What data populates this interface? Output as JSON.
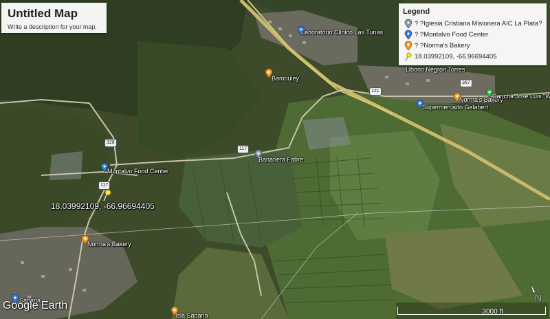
{
  "map": {
    "title": "Untitled Map",
    "description": "Write a description for your map.",
    "logo": "Google Earth",
    "scale_label": "3000 ft",
    "compass": "N"
  },
  "legend": {
    "heading": "Legend",
    "items": [
      {
        "label": "? ?Iglesia Cristiana Misionera AIC La Plata?",
        "icon": "gray-pin-icon",
        "color": "#8a9bb0"
      },
      {
        "label": "? ?Montalvo Food Center",
        "icon": "blue-pin-icon",
        "color": "#3b7ad9"
      },
      {
        "label": "? ?Norma's Bakery",
        "icon": "orange-pin-icon",
        "color": "#f0a028"
      },
      {
        "label": "18.03992109, -66.96694405",
        "icon": "yellow-pushpin-icon",
        "color": "#f4e62a"
      }
    ]
  },
  "places": {
    "laboratorio": "Laboratorio Clinico Las Tunas",
    "bambuley": "Bambuley",
    "liborio": "Liborio Negron Torres",
    "normas_top": "Norma's Bakery",
    "supermercado": "Supermercado Gelabert",
    "cancha": "Cancha Jose Luis \"Wito\"",
    "bananera": "Bananera Fabre",
    "montalvo": "Montalvo Food Center",
    "coord": "18.03992109, -66.96694405",
    "normas": "Norma's Bakery",
    "isla": "Isla Sabana",
    "sabana": "Sabana"
  },
  "roads": {
    "r328": "328",
    "r117a": "117",
    "r117b": "117",
    "r121": "121",
    "r367": "367"
  }
}
